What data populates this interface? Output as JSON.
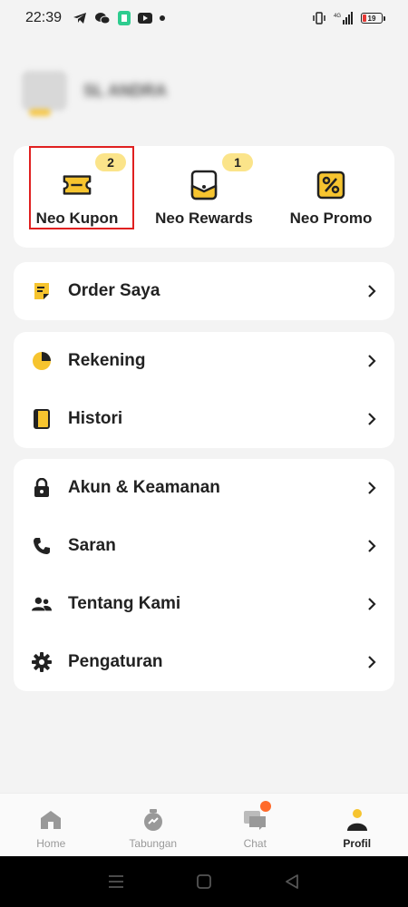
{
  "status_bar": {
    "time": "22:39",
    "battery_level": "19",
    "network_label": "4G"
  },
  "profile": {
    "name": "SL ANDRA"
  },
  "quick_actions": [
    {
      "label": "Neo Kupon",
      "badge": "2",
      "icon": "ticket-icon"
    },
    {
      "label": "Neo Rewards",
      "badge": "1",
      "icon": "envelope-icon"
    },
    {
      "label": "Neo Promo",
      "badge": "",
      "icon": "percent-icon"
    }
  ],
  "menu_group_1": [
    {
      "label": "Order Saya",
      "icon": "order-note-icon"
    }
  ],
  "menu_group_2": [
    {
      "label": "Rekening",
      "icon": "pie-chart-icon"
    },
    {
      "label": "Histori",
      "icon": "book-icon"
    }
  ],
  "menu_group_3": [
    {
      "label": "Akun & Keamanan",
      "icon": "lock-icon"
    },
    {
      "label": "Saran",
      "icon": "phone-icon"
    },
    {
      "label": "Tentang Kami",
      "icon": "people-icon"
    },
    {
      "label": "Pengaturan",
      "icon": "gear-icon"
    }
  ],
  "bottom_nav": [
    {
      "label": "Home",
      "icon": "home-icon"
    },
    {
      "label": "Tabungan",
      "icon": "savings-icon"
    },
    {
      "label": "Chat",
      "icon": "chat-icon"
    },
    {
      "label": "Profil",
      "icon": "profile-icon",
      "active": true
    }
  ],
  "colors": {
    "accent_yellow": "#f6c42f",
    "badge_yellow": "#fbe48a",
    "highlight_red": "#e02020",
    "chat_dot": "#ff6a2b"
  }
}
